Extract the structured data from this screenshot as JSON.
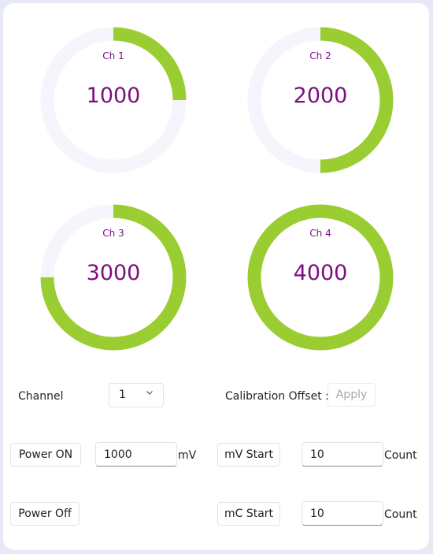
{
  "gauges": [
    {
      "label": "Ch 1",
      "value": "1000",
      "progress": 0.25
    },
    {
      "label": "Ch 2",
      "value": "2000",
      "progress": 0.5
    },
    {
      "label": "Ch 3",
      "value": "3000",
      "progress": 0.75
    },
    {
      "label": "Ch 4",
      "value": "4000",
      "progress": 1.0
    }
  ],
  "colors": {
    "ring_fill": "#9acd32",
    "ring_track": "#f5f5fb",
    "gauge_text": "#7b0f80",
    "background": "#e8e9f6"
  },
  "controls": {
    "channel_label": "Channel",
    "channel_value": "1",
    "calibration_label": "Calibration Offset :",
    "apply_label": "Apply",
    "power_on_label": "Power ON",
    "power_on_value": "1000",
    "power_on_unit": "mV",
    "mv_start_label": "mV Start",
    "mv_start_value": "10",
    "mv_start_unit": "Count",
    "power_off_label": "Power Off",
    "mc_start_label": "mC Start",
    "mc_start_value": "10",
    "mc_start_unit": "Count"
  }
}
